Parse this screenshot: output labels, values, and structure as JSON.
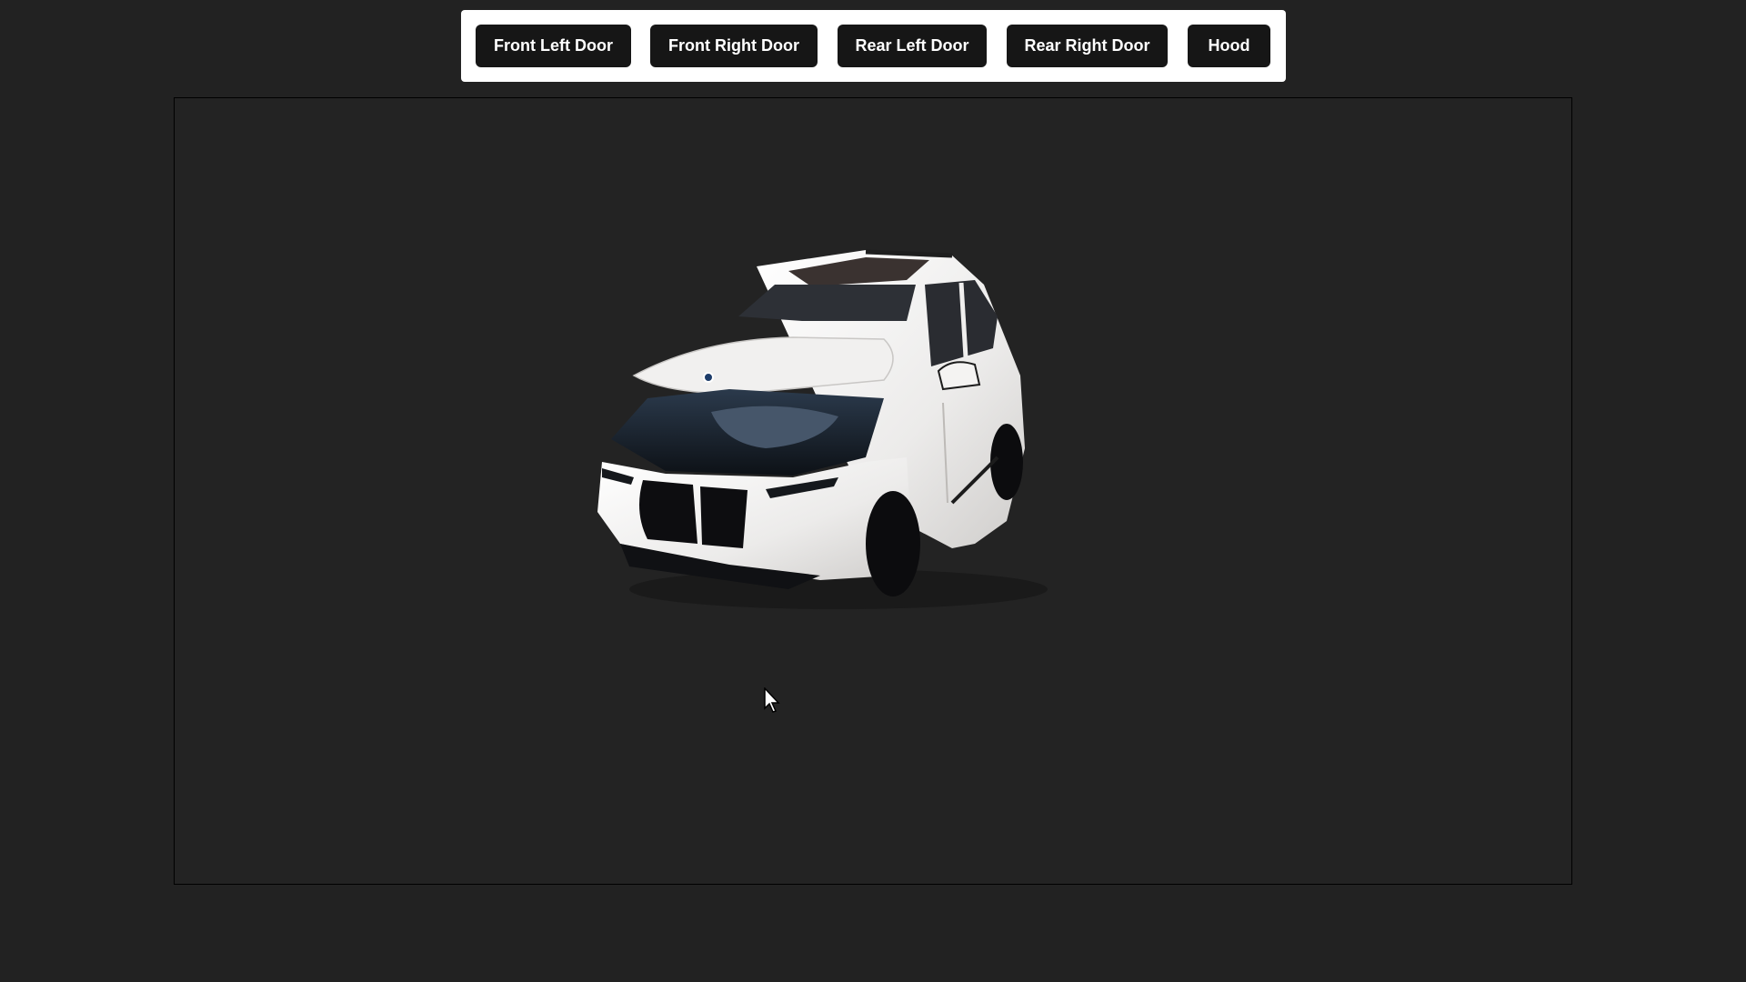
{
  "toolbar": {
    "buttons": [
      {
        "label": "Front Left Door"
      },
      {
        "label": "Front Right Door"
      },
      {
        "label": "Rear Left Door"
      },
      {
        "label": "Rear Right Door"
      },
      {
        "label": "Hood"
      }
    ]
  },
  "viewer": {
    "model": "car-3d-model",
    "body_color": "#f2f0ee",
    "trim_color": "#141418",
    "background_color": "#232323"
  },
  "cursor": {
    "icon": "mouse-pointer-icon"
  }
}
